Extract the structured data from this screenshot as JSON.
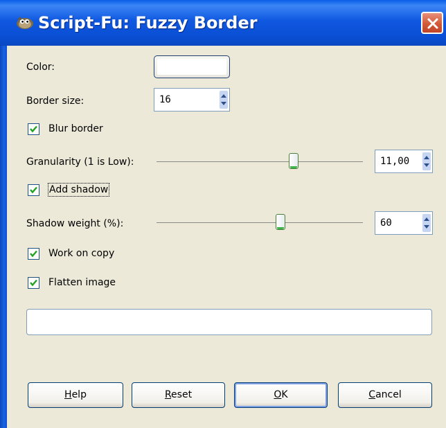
{
  "window": {
    "title": "Script-Fu: Fuzzy Border",
    "close_icon": "close-icon",
    "app_icon": "gimp-wilber-icon"
  },
  "form": {
    "color_label": "Color:",
    "color_value": "#ffffff",
    "border_size_label": "Border size:",
    "border_size_value": "16",
    "blur_border_label": "Blur border",
    "blur_border_checked": true,
    "granularity_label": "Granularity (1 is Low):",
    "granularity_value": "11,00",
    "add_shadow_label": "Add shadow",
    "add_shadow_checked": true,
    "shadow_weight_label": "Shadow weight (%):",
    "shadow_weight_value": "60",
    "work_on_copy_label": "Work on copy",
    "work_on_copy_checked": true,
    "flatten_image_label": "Flatten image",
    "flatten_image_checked": true,
    "progress_text": ""
  },
  "buttons": {
    "help": {
      "prefix": "",
      "mnemonic": "H",
      "rest": "elp"
    },
    "reset": {
      "prefix": "",
      "mnemonic": "R",
      "rest": "eset"
    },
    "ok": {
      "prefix": "",
      "mnemonic": "O",
      "rest": "K"
    },
    "cancel": {
      "prefix": "",
      "mnemonic": "C",
      "rest": "ancel"
    }
  },
  "colors": {
    "titlebar": "#0a5ee8",
    "dialog_bg": "#ece9d8",
    "check": "#21a121"
  }
}
